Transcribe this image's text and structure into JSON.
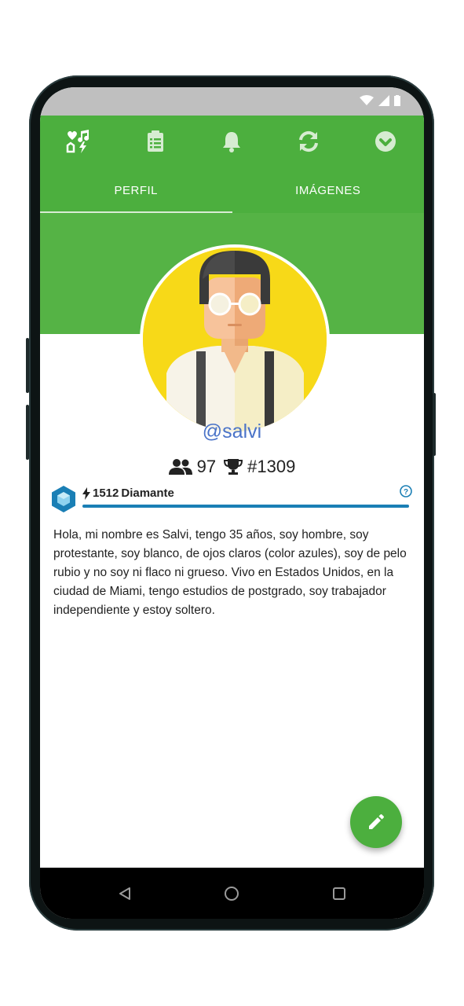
{
  "colors": {
    "primary": "#4caf3e",
    "cover": "#55b345",
    "username": "#4a73c8",
    "level_bar": "#1a7fb5",
    "fab": "#4caf3e"
  },
  "toolbar": {
    "icons": [
      "preferences-icon",
      "clipboard-icon",
      "bell-icon",
      "sync-icon",
      "check-circle-icon"
    ]
  },
  "tabs": [
    {
      "label": "PERFIL",
      "active": true
    },
    {
      "label": "IMÁGENES",
      "active": false
    }
  ],
  "profile": {
    "username": "@salvi",
    "friends_count": "97",
    "rank": "#1309",
    "level_points": "1512",
    "level_name": "Diamante",
    "level_progress": 1.0,
    "bio": "Hola, mi nombre es Salvi, tengo 35 años, soy hombre, soy protestante, soy blanco, de ojos claros (color azules), soy de pelo rubio y no soy ni flaco ni grueso. Vivo en Estados Unidos, en la ciudad de Miami, tengo estudios de postgrado, soy trabajador independiente y estoy soltero."
  },
  "fab": {
    "icon": "pencil-icon"
  },
  "navbar": {
    "icons": [
      "back-icon",
      "home-icon",
      "recents-icon"
    ]
  }
}
